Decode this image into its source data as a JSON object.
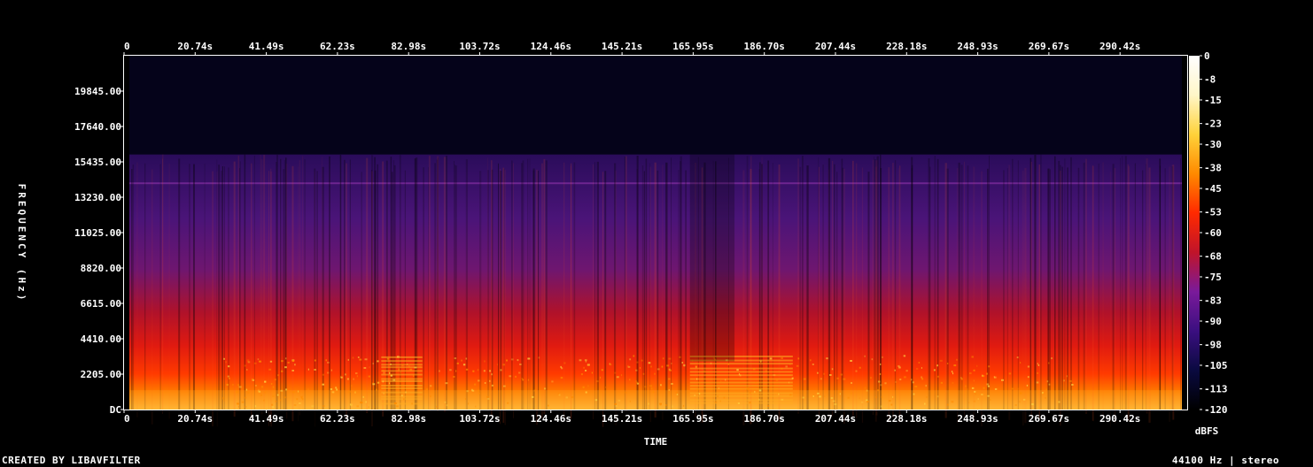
{
  "footer": {
    "left": "CREATED BY LIBAVFILTER",
    "right": "44100 Hz | stereo"
  },
  "chart_data": {
    "type": "heatmap",
    "title": "",
    "xlabel": "TIME",
    "ylabel": "FREQUENCY (Hz)",
    "x_ticks": [
      "0",
      "20.74s",
      "41.49s",
      "62.23s",
      "82.98s",
      "103.72s",
      "124.46s",
      "145.21s",
      "165.95s",
      "186.70s",
      "207.44s",
      "228.18s",
      "248.93s",
      "269.67s",
      "290.42s"
    ],
    "x_tick_values": [
      0,
      20.74,
      41.49,
      62.23,
      82.98,
      103.72,
      124.46,
      145.21,
      165.95,
      186.7,
      207.44,
      228.18,
      248.93,
      269.67,
      290.42
    ],
    "xlim": [
      0,
      310
    ],
    "y_ticks": [
      "DC",
      "2205.00",
      "4410.00",
      "6615.00",
      "8820.00",
      "11025.00",
      "13230.00",
      "15435.00",
      "17640.00",
      "19845.00"
    ],
    "y_tick_values": [
      0,
      2205,
      4410,
      6615,
      8820,
      11025,
      13230,
      15435,
      17640,
      19845
    ],
    "ylim": [
      0,
      22050
    ],
    "colorbar": {
      "label": "dBFS",
      "ticks": [
        "0",
        "-8",
        "-15",
        "-23",
        "-30",
        "-38",
        "-45",
        "-53",
        "-60",
        "-68",
        "-75",
        "-83",
        "-90",
        "-98",
        "-105",
        "-113",
        "-120"
      ],
      "tick_values": [
        0,
        -8,
        -15,
        -23,
        -30,
        -38,
        -45,
        -53,
        -60,
        -68,
        -75,
        -83,
        -90,
        -98,
        -105,
        -113,
        -120
      ],
      "range": [
        -120,
        0
      ],
      "stops": [
        "#000000",
        "#0a0a40",
        "#3b0f80",
        "#7a1a9a",
        "#c0142a",
        "#ff2a00",
        "#ff8a00",
        "#ffd23a",
        "#fff6c8",
        "#ffffff"
      ]
    },
    "cutoff_frequency": 15900,
    "tone_frequency": 14100,
    "quiet_regions_s": [
      [
        165,
        178
      ]
    ],
    "busy_regions_s": [
      [
        75,
        87
      ],
      [
        165,
        195
      ]
    ],
    "colors": {
      "background": "#000000",
      "text": "#ffffff",
      "frame": "#ffffff"
    }
  }
}
